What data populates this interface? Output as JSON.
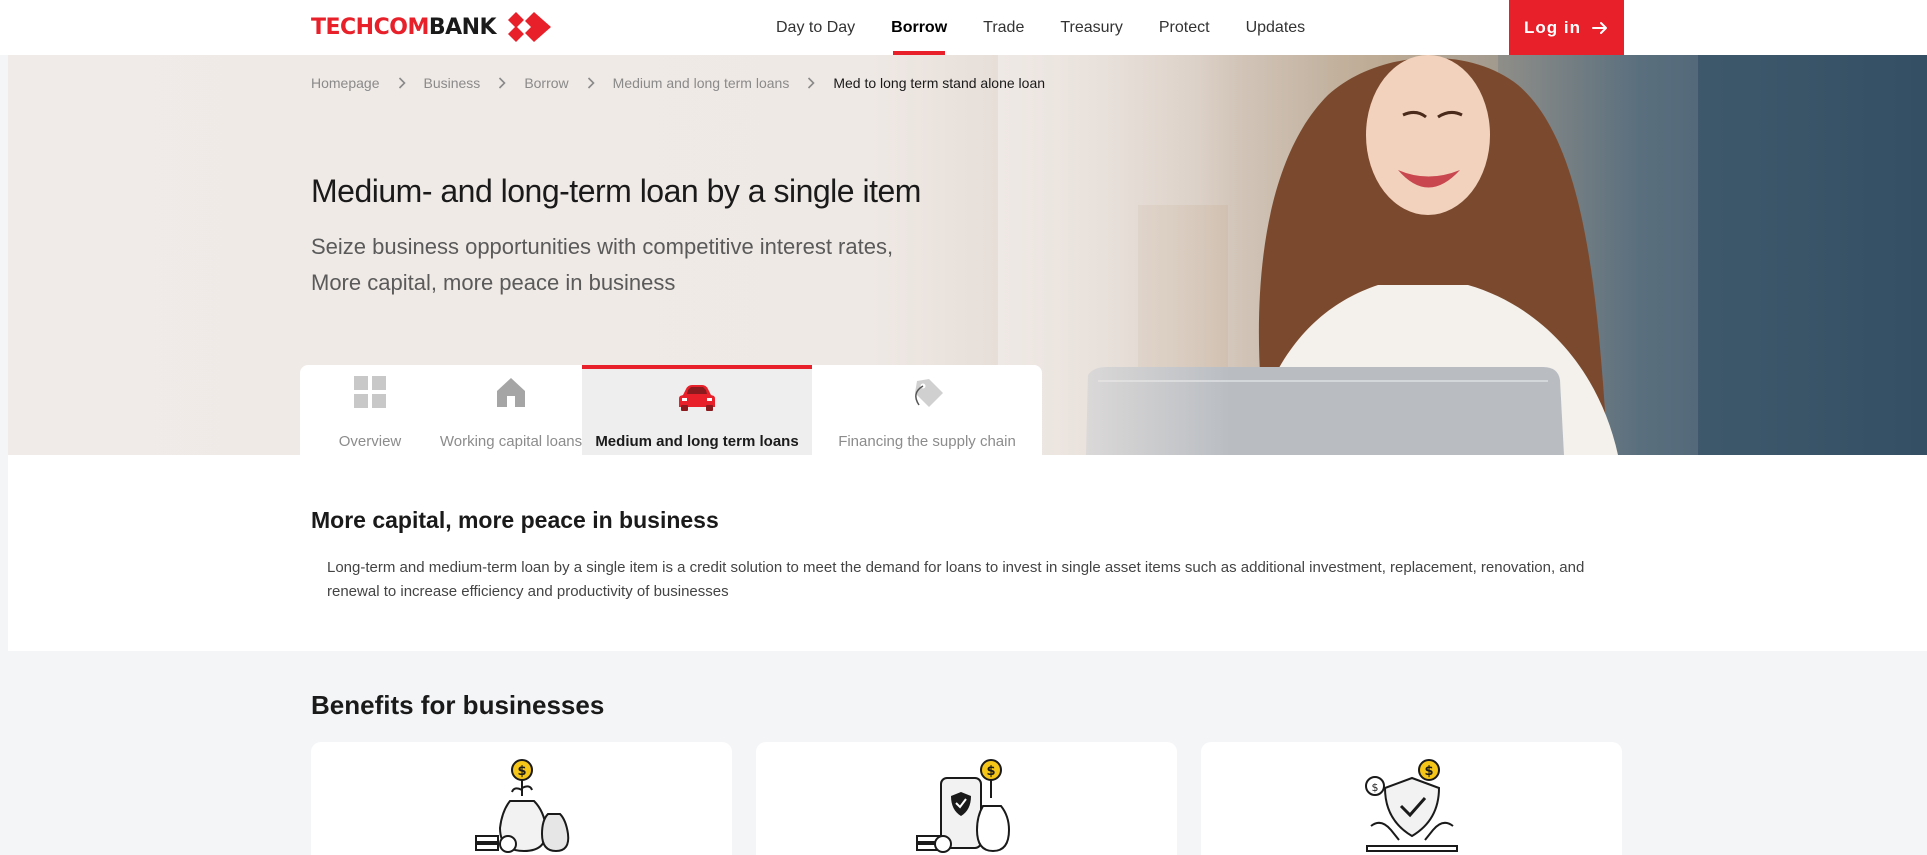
{
  "header": {
    "logo_text_red": "TECHCOM",
    "logo_text_dark": "BANK",
    "nav": [
      "Day to Day",
      "Borrow",
      "Trade",
      "Treasury",
      "Protect",
      "Updates"
    ],
    "active_nav": "Borrow",
    "login_label": "Log in"
  },
  "breadcrumb": [
    "Homepage",
    "Business",
    "Borrow",
    "Medium and long term loans",
    "Med to long term stand alone loan"
  ],
  "hero": {
    "title": "Medium- and long-term loan by a single item",
    "subtitle_line1": "Seize business opportunities with competitive interest rates,",
    "subtitle_line2": "More capital, more peace in business"
  },
  "tabs": [
    {
      "label": "Overview",
      "icon": "grid-icon"
    },
    {
      "label": "Working capital loans",
      "icon": "house-icon"
    },
    {
      "label": "Medium and long term loans",
      "icon": "car-icon",
      "active": true
    },
    {
      "label": "Financing the supply chain",
      "icon": "tag-icon"
    }
  ],
  "section": {
    "title": "More capital, more peace in business",
    "text": "Long-term and medium-term loan by a single item is a credit solution to meet the demand for loans to invest in single asset items such as additional investment, replacement, renovation, and renewal to increase efficiency and productivity of businesses"
  },
  "benefits": {
    "title": "Benefits for businesses",
    "cards": [
      {
        "icon": "money-bag-plant-icon"
      },
      {
        "icon": "phone-shield-money-icon"
      },
      {
        "icon": "shield-check-hands-icon"
      }
    ]
  },
  "colors": {
    "brand_red": "#e8202a",
    "coin_yellow": "#f5c518"
  }
}
